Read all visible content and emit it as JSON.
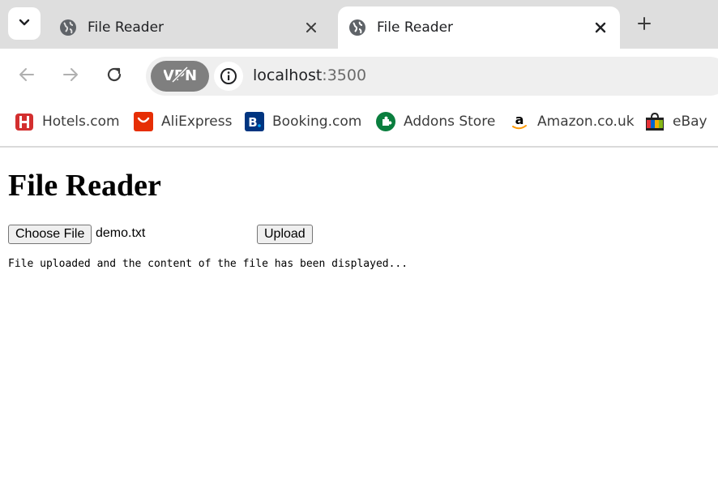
{
  "browser": {
    "tabs": [
      {
        "title": "File Reader",
        "active": false
      },
      {
        "title": "File Reader",
        "active": true
      }
    ],
    "address": {
      "host": "localhost",
      "port": ":3500"
    },
    "vpn_label": "VPN",
    "bookmarks": [
      {
        "label": "Hotels.com",
        "icon": "hotels-icon",
        "color": "#d32f2f"
      },
      {
        "label": "AliExpress",
        "icon": "aliexpress-icon",
        "color": "#e62e04"
      },
      {
        "label": "Booking.com",
        "icon": "booking-icon",
        "color": "#003580"
      },
      {
        "label": "Addons Store",
        "icon": "addons-icon",
        "color": "#0a7e3e"
      },
      {
        "label": "Amazon.co.uk",
        "icon": "amazon-icon",
        "color": "#f90"
      },
      {
        "label": "eBay",
        "icon": "ebay-icon",
        "color": "#e53238"
      }
    ]
  },
  "page": {
    "heading": "File Reader",
    "choose_file_label": "Choose File",
    "chosen_file": "demo.txt",
    "upload_label": "Upload",
    "result_text": "File uploaded and the content of the file has been displayed..."
  }
}
